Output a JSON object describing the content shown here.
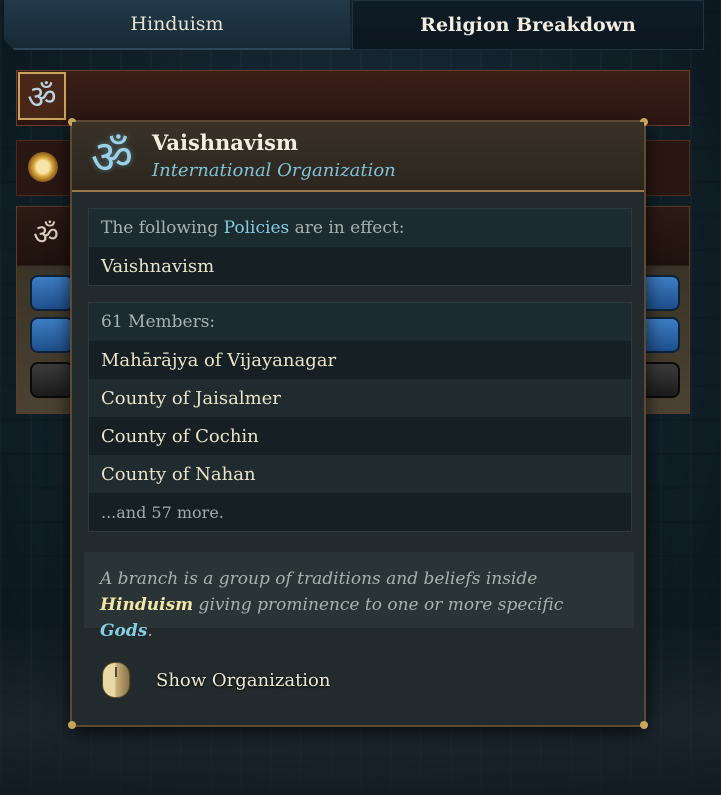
{
  "tabs": {
    "left": "Hinduism",
    "right": "Religion Breakdown"
  },
  "tooltip": {
    "title": "Vaishnavism",
    "subtitle": "International Organization",
    "policies": {
      "prefix": "The following ",
      "keyword": "Policies",
      "suffix": " are in effect:",
      "items": [
        "Vaishnavism"
      ]
    },
    "members": {
      "header": "61 Members:",
      "items": [
        "Mahārājya of Vijayanagar",
        "County of Jaisalmer",
        "County of Cochin",
        "County of Nahan"
      ],
      "more": "...and 57 more."
    },
    "description": {
      "part1": "A branch is a group of traditions and beliefs inside ",
      "keyword1": "Hinduism",
      "part2": " giving prominence to one or more specific ",
      "keyword2": "Gods",
      "part3": "."
    },
    "action_label": "Show Organization"
  },
  "icons": {
    "om": "ॐ",
    "religion": "om-icon",
    "sun": "sunburst-icon",
    "mouse": "mouse-icon"
  },
  "colors": {
    "accent_gold": "#c9a55c",
    "link_blue": "#86cde2",
    "keyword_yellow": "#f2e6a4"
  }
}
